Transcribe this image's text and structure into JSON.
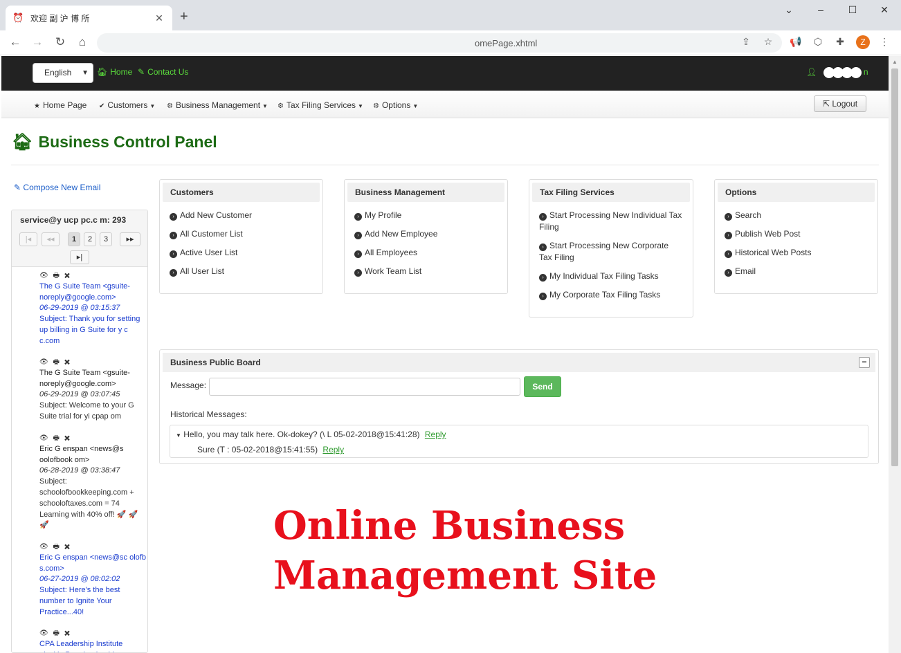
{
  "browser": {
    "tab_title": "欢迎 副 沪 博 所",
    "tab_close": "✕",
    "new_tab": "+",
    "url": "omePage.xhtml",
    "profile_initial": "Z",
    "window_controls": {
      "minimize": "–",
      "maximize": "☐",
      "close": "✕"
    }
  },
  "topbar": {
    "language": "English",
    "home": "Home",
    "contact": "Contact Us",
    "user": "n"
  },
  "menu": {
    "items": [
      "Home Page",
      "Customers",
      "Business Management",
      "Tax Filing Services",
      "Options"
    ],
    "logout": "Logout"
  },
  "page_title": "Business Control Panel",
  "email": {
    "compose": "Compose New Email",
    "account": "service@y  ucp  pc.c m: 293",
    "pages": [
      "1",
      "2",
      "3"
    ],
    "current_page": "1",
    "items": [
      {
        "from": "The G Suite Team <gsuite-noreply@google.com>",
        "date": "06-29-2019 @ 03:15:37",
        "subject": "Subject: Thank you for setting up billing in G Suite for y  c  c.com",
        "unread": true
      },
      {
        "from": "The G Suite Team <gsuite-noreply@google.com>",
        "date": "06-29-2019 @ 03:07:45",
        "subject": "Subject: Welcome to your G Suite trial for yi   cpap    om",
        "unread": false
      },
      {
        "from": "Eric G  enspan <news@s  oolofbook  om>",
        "date": "06-28-2019 @ 03:38:47",
        "subject": "Subject: schoolofbookkeeping.com + schooloftaxes.com = 74 Learning with 40% off! 🚀 🚀 🚀",
        "unread": false
      },
      {
        "from": "Eric G  enspan <news@sc  olofb  s.com>",
        "date": "06-27-2019 @ 08:02:02",
        "subject": "Subject: Here's the best number to Ignite Your Practice...40!",
        "unread": true
      },
      {
        "from": "CPA Leadership Institute <jackie@cpaleadership.com>",
        "date": "",
        "subject": "",
        "unread": true
      }
    ]
  },
  "panels": {
    "customers": {
      "title": "Customers",
      "links": [
        "Add New Customer",
        "All Customer List",
        "Active User List",
        "All User List"
      ]
    },
    "business": {
      "title": "Business Management",
      "links": [
        "My Profile",
        "Add New Employee",
        "All Employees",
        "Work Team List"
      ]
    },
    "tax": {
      "title": "Tax Filing Services",
      "links": [
        "Start Processing New Individual Tax Filing",
        "Start Processing New Corporate Tax Filing",
        "My Individual Tax Filing Tasks",
        "My Corporate Tax Filing Tasks"
      ]
    },
    "options": {
      "title": "Options",
      "links": [
        "Search",
        "Publish Web Post",
        "Historical Web Posts",
        "Email"
      ]
    }
  },
  "board": {
    "title": "Business Public Board",
    "message_label": "Message:",
    "message_value": "",
    "send": "Send",
    "history_label": "Historical Messages:",
    "messages": [
      {
        "text": "Hello, you may talk here. Ok-dokey? (\\   L    05-02-2018@15:41:28)",
        "reply": "Reply"
      },
      {
        "text": "Sure (T         : 05-02-2018@15:41:55)",
        "reply": "Reply"
      }
    ]
  },
  "promo": {
    "line1": "Online Business",
    "line2": "Management Site"
  }
}
